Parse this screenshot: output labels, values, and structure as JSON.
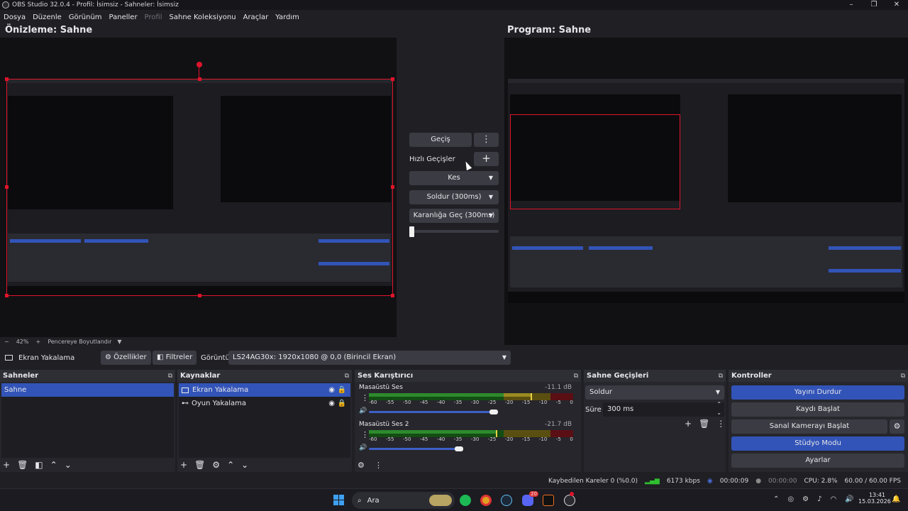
{
  "window": {
    "title": "OBS Studio 32.0.4 - Profil: İsimsiz - Sahneler: İsimsiz",
    "controls": [
      "–",
      "❐",
      "✕"
    ]
  },
  "menu": [
    "Dosya",
    "Düzenle",
    "Görünüm",
    "Paneller",
    "Profil",
    "Sahne Koleksiyonu",
    "Araçlar",
    "Yardım"
  ],
  "preview": {
    "title": "Önizleme: Sahne"
  },
  "program": {
    "title": "Program: Sahne"
  },
  "transition_controls": {
    "transition_button": "Geçiş",
    "quick_transitions_label": "Hızlı Geçişler",
    "quick_items": [
      "Kes",
      "Soldur (300ms)",
      "Karanlığa Geç (300ms)"
    ]
  },
  "zoom": {
    "minus": "−",
    "value": "42%",
    "plus": "+",
    "mode": "Pencereye Boyutlandır"
  },
  "source_bar": {
    "selected_source": "Ekran Yakalama",
    "properties": "Özellikler",
    "filters": "Filtreler",
    "display_label": "Görüntü",
    "display_value": "LS24AG30x: 1920x1080 @ 0,0 (Birincil Ekran)"
  },
  "scenes": {
    "title": "Sahneler",
    "items": [
      "Sahne"
    ]
  },
  "sources": {
    "title": "Kaynaklar",
    "items": [
      "Ekran Yakalama",
      "Oyun Yakalama"
    ]
  },
  "mixer": {
    "title": "Ses Karıştırıcı",
    "channels": [
      {
        "name": "Masaüstü Ses",
        "db": "-11.1 dB",
        "level": 0.79,
        "volume": 0.61
      },
      {
        "name": "Masaüstü Ses 2",
        "db": "-21.7 dB",
        "level": 0.62,
        "volume": 0.44
      }
    ],
    "ticks": [
      "-60",
      "-55",
      "-50",
      "-45",
      "-40",
      "-35",
      "-30",
      "-25",
      "-20",
      "-15",
      "-10",
      "-5",
      "0"
    ]
  },
  "transitions_panel": {
    "title": "Sahne Geçişleri",
    "selected": "Soldur",
    "duration_label": "Süre",
    "duration_value": "300 ms"
  },
  "controls": {
    "title": "Kontroller",
    "buttons": [
      "Yayını Durdur",
      "Kaydı Başlat",
      "Sanal Kamerayı Başlat",
      "Stüdyo Modu",
      "Ayarlar"
    ]
  },
  "status": {
    "dropped": "Kaybedilen Kareler 0 (%0.0)",
    "bitrate": "6173 kbps",
    "stream_time": "00:00:09",
    "rec_time": "00:00:00",
    "cpu": "CPU: 2.8%",
    "fps": "60.00 / 60.00 FPS"
  },
  "taskbar": {
    "search": "Ara",
    "time": "13:41",
    "date": "15.03.2026",
    "badge": "20"
  },
  "colors": {
    "accent": "#3254b8",
    "red": "#e0142a",
    "meter_green": "#2d8a2d"
  }
}
